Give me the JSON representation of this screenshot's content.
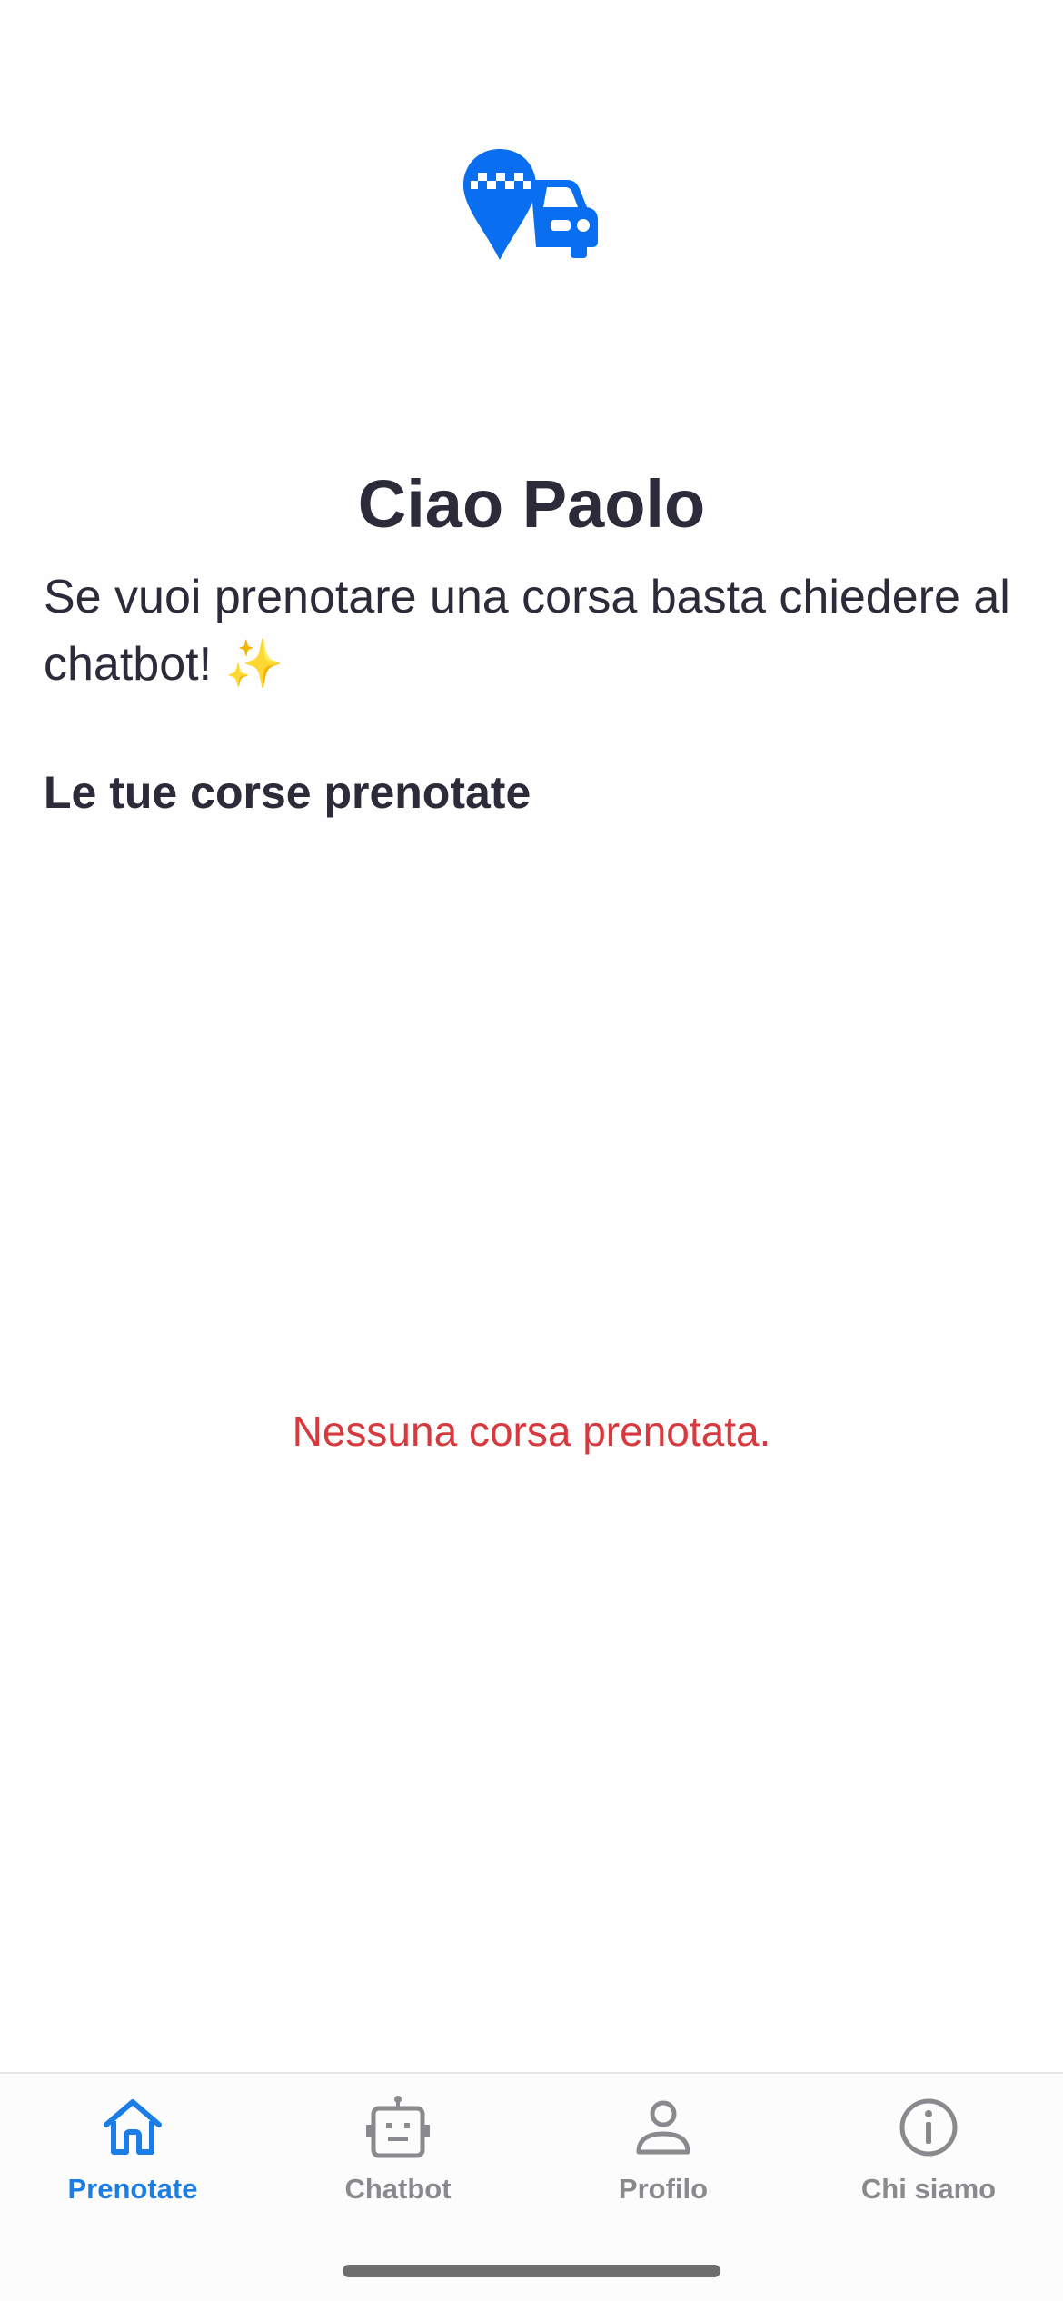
{
  "header": {
    "logo_icon": "taxi-pin-car-icon",
    "brand_color": "#0a6ef0"
  },
  "main": {
    "title": "Ciao Paolo",
    "subtitle": "Se vuoi prenotare una corsa basta chiedere al chatbot! ✨",
    "section_heading": "Le tue corse prenotate",
    "empty_message": "Nessuna corsa prenotata.",
    "empty_message_color": "#d63a3e"
  },
  "tabbar": {
    "active_color": "#1a7ee6",
    "inactive_color": "#8a8a8e",
    "tabs": [
      {
        "label": "Prenotate",
        "icon": "home-icon",
        "active": true
      },
      {
        "label": "Chatbot",
        "icon": "robot-icon",
        "active": false
      },
      {
        "label": "Profilo",
        "icon": "person-icon",
        "active": false
      },
      {
        "label": "Chi siamo",
        "icon": "info-icon",
        "active": false
      }
    ]
  }
}
